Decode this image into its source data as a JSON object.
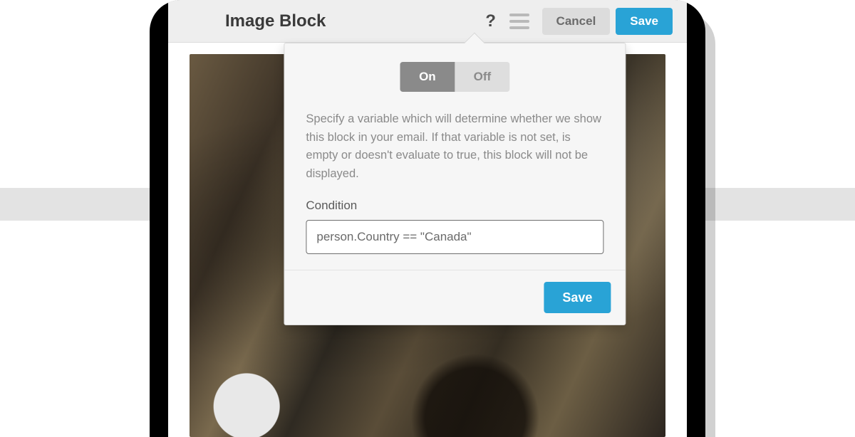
{
  "toolbar": {
    "title": "Image Block",
    "cancel_label": "Cancel",
    "save_label": "Save"
  },
  "popover": {
    "toggle": {
      "on_label": "On",
      "off_label": "Off",
      "active": "on"
    },
    "description": "Specify a variable which will determine whether we show this block in your email. If that variable is not set, is empty or doesn't evaluate to true, this block will not be displayed.",
    "condition_label": "Condition",
    "condition_value": "person.Country == \"Canada\"",
    "save_label": "Save"
  }
}
